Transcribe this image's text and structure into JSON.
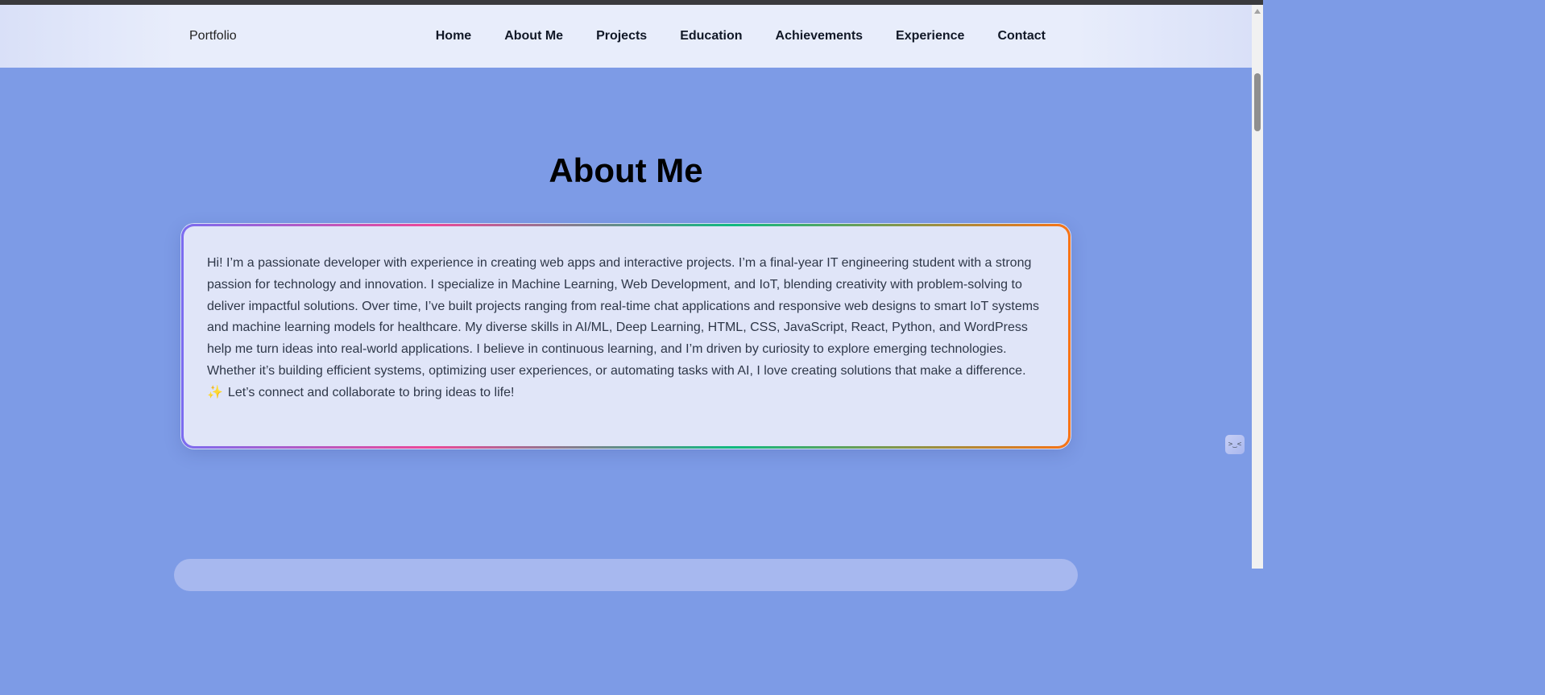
{
  "navbar": {
    "brand": "Portfolio",
    "links": [
      "Home",
      "About Me",
      "Projects",
      "Education",
      "Achievements",
      "Experience",
      "Contact"
    ]
  },
  "about": {
    "title": "About Me",
    "body": "Hi! I’m a passionate developer with experience in creating web apps and interactive projects. I’m a final-year IT engineering student with a strong passion for technology and innovation. I specialize in Machine Learning, Web Development, and IoT, blending creativity with problem-solving to deliver impactful solutions. Over time, I’ve built projects ranging from real-time chat applications and responsive web designs to smart IoT systems and machine learning models for healthcare. My diverse skills in AI/ML, Deep Learning, HTML, CSS, JavaScript, React, Python, and WordPress help me turn ideas into real-world applications. I believe in continuous learning, and I’m driven by curiosity to explore emerging technologies. Whether it’s building efficient systems, optimizing user experiences, or automating tasks with AI, I love creating solutions that make a difference.",
    "cta_icon": "✨",
    "cta": "Let’s connect and collaborate to bring ideas to life!"
  },
  "widget": {
    "glyph": ">‿<",
    "icon": "chat-widget-icon"
  },
  "colors": {
    "page_background": "#7d9be6",
    "navbar_background": "#e8edfb",
    "card_background": "#e0e5f8",
    "text": "#2e3748"
  }
}
